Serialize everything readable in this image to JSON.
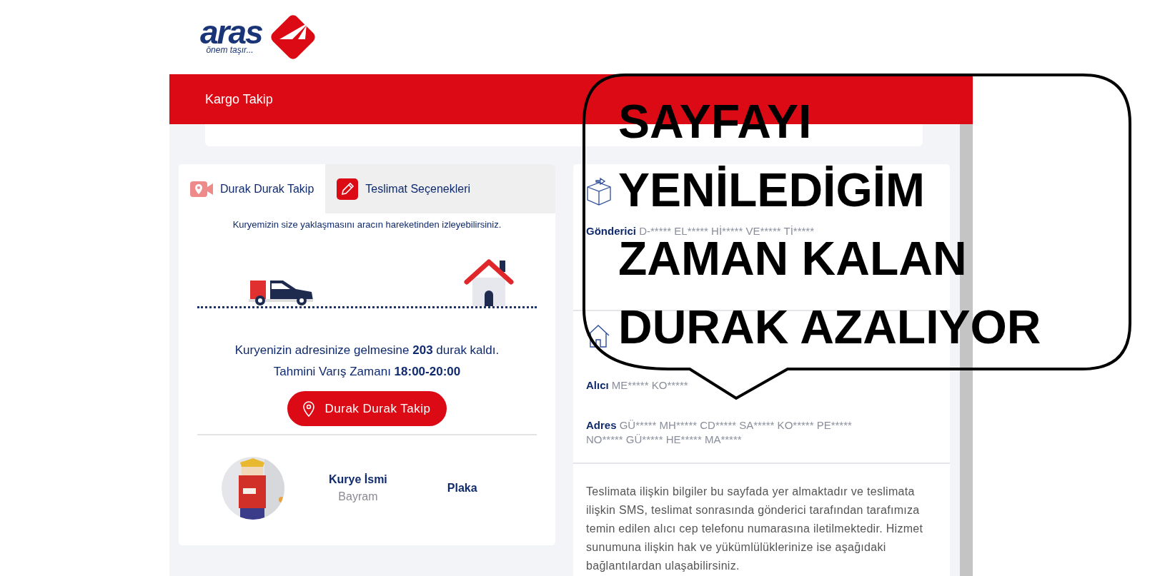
{
  "logo": {
    "wordmark": "aras",
    "tagline": "önem taşır..."
  },
  "nav": {
    "title": "Kargo Takip"
  },
  "tabs": [
    {
      "label": "Durak Durak Takip",
      "kind": "tracking",
      "selected": true
    },
    {
      "label": "Teslimat Seçenekleri",
      "kind": "options",
      "selected": false
    }
  ],
  "tracking": {
    "hint": "Kuryemizin size yaklaşmasını aracın hareketinden izleyebilirsiniz.",
    "status_lines": [
      "Kuryenizin adresinize gelmesine **203** durak kaldı.",
      "Tahmini Varış Zamanı **18:00-20:00**"
    ],
    "button": "Durak Durak Takip",
    "courier": {
      "name_label": "Kurye İsmi",
      "name": "Bayram",
      "plate_label": "Plaka"
    }
  },
  "sections": [
    {
      "kind": "sender",
      "rows": [
        {
          "label": "Gönderici",
          "value": "D-***** EL***** Hİ***** VE***** Tİ*****"
        }
      ]
    },
    {
      "kind": "receiver",
      "rows": [
        {
          "label": "Alıcı",
          "value": "ME***** KO*****"
        },
        {
          "label": "Adres",
          "value": "GÜ***** MH***** CD***** SA***** KO***** PE***** NO***** GÜ***** HE***** MA*****"
        }
      ]
    }
  ],
  "notice": "Teslimata ilişkin bilgiler bu sayfada yer almaktadır ve teslimata ilişkin SMS, teslimat sonrasında gönderici tarafından tarafımıza temin edilen alıcı cep telefonu numarasına iletilmektedir. Hizmet sunumuna ilişkin hak ve yükümlülüklerinize ise aşağıdaki bağlantılardan ulaşabilirsiniz.",
  "annotation": {
    "lines": [
      "SAYFAYI",
      "YENİLEDİGİM",
      "ZAMAN KALAN",
      "DURAK AZALIYOR"
    ]
  }
}
